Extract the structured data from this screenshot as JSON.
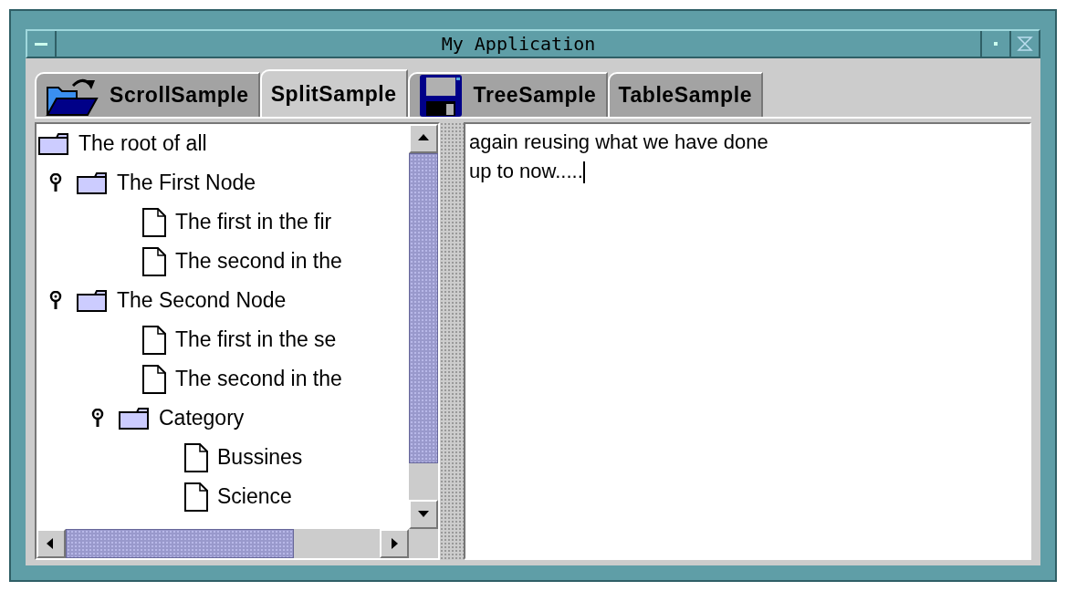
{
  "window": {
    "title": "My Application"
  },
  "tabs": [
    {
      "label": "ScrollSample",
      "kind": "folder",
      "selected": false
    },
    {
      "label": "SplitSample",
      "kind": "plain",
      "selected": true
    },
    {
      "label": "TreeSample",
      "kind": "disk",
      "selected": false
    },
    {
      "label": "TableSample",
      "kind": "plain",
      "selected": false
    }
  ],
  "tree": {
    "label": "The root of all",
    "kind": "folder",
    "children": [
      {
        "label": "The First Node",
        "kind": "folder",
        "expanded": true,
        "children": [
          {
            "label": "The first in the fir",
            "kind": "leaf"
          },
          {
            "label": "The second in the",
            "kind": "leaf"
          }
        ]
      },
      {
        "label": "The Second Node",
        "kind": "folder",
        "expanded": true,
        "children": [
          {
            "label": "The first in the se",
            "kind": "leaf"
          },
          {
            "label": "The second in the",
            "kind": "leaf"
          },
          {
            "label": "Category",
            "kind": "folder",
            "expanded": true,
            "children": [
              {
                "label": "Bussines",
                "kind": "leaf"
              },
              {
                "label": "Science",
                "kind": "leaf"
              }
            ]
          }
        ]
      }
    ]
  },
  "editor": {
    "text": "again reusing what we have done\nup to now....."
  }
}
